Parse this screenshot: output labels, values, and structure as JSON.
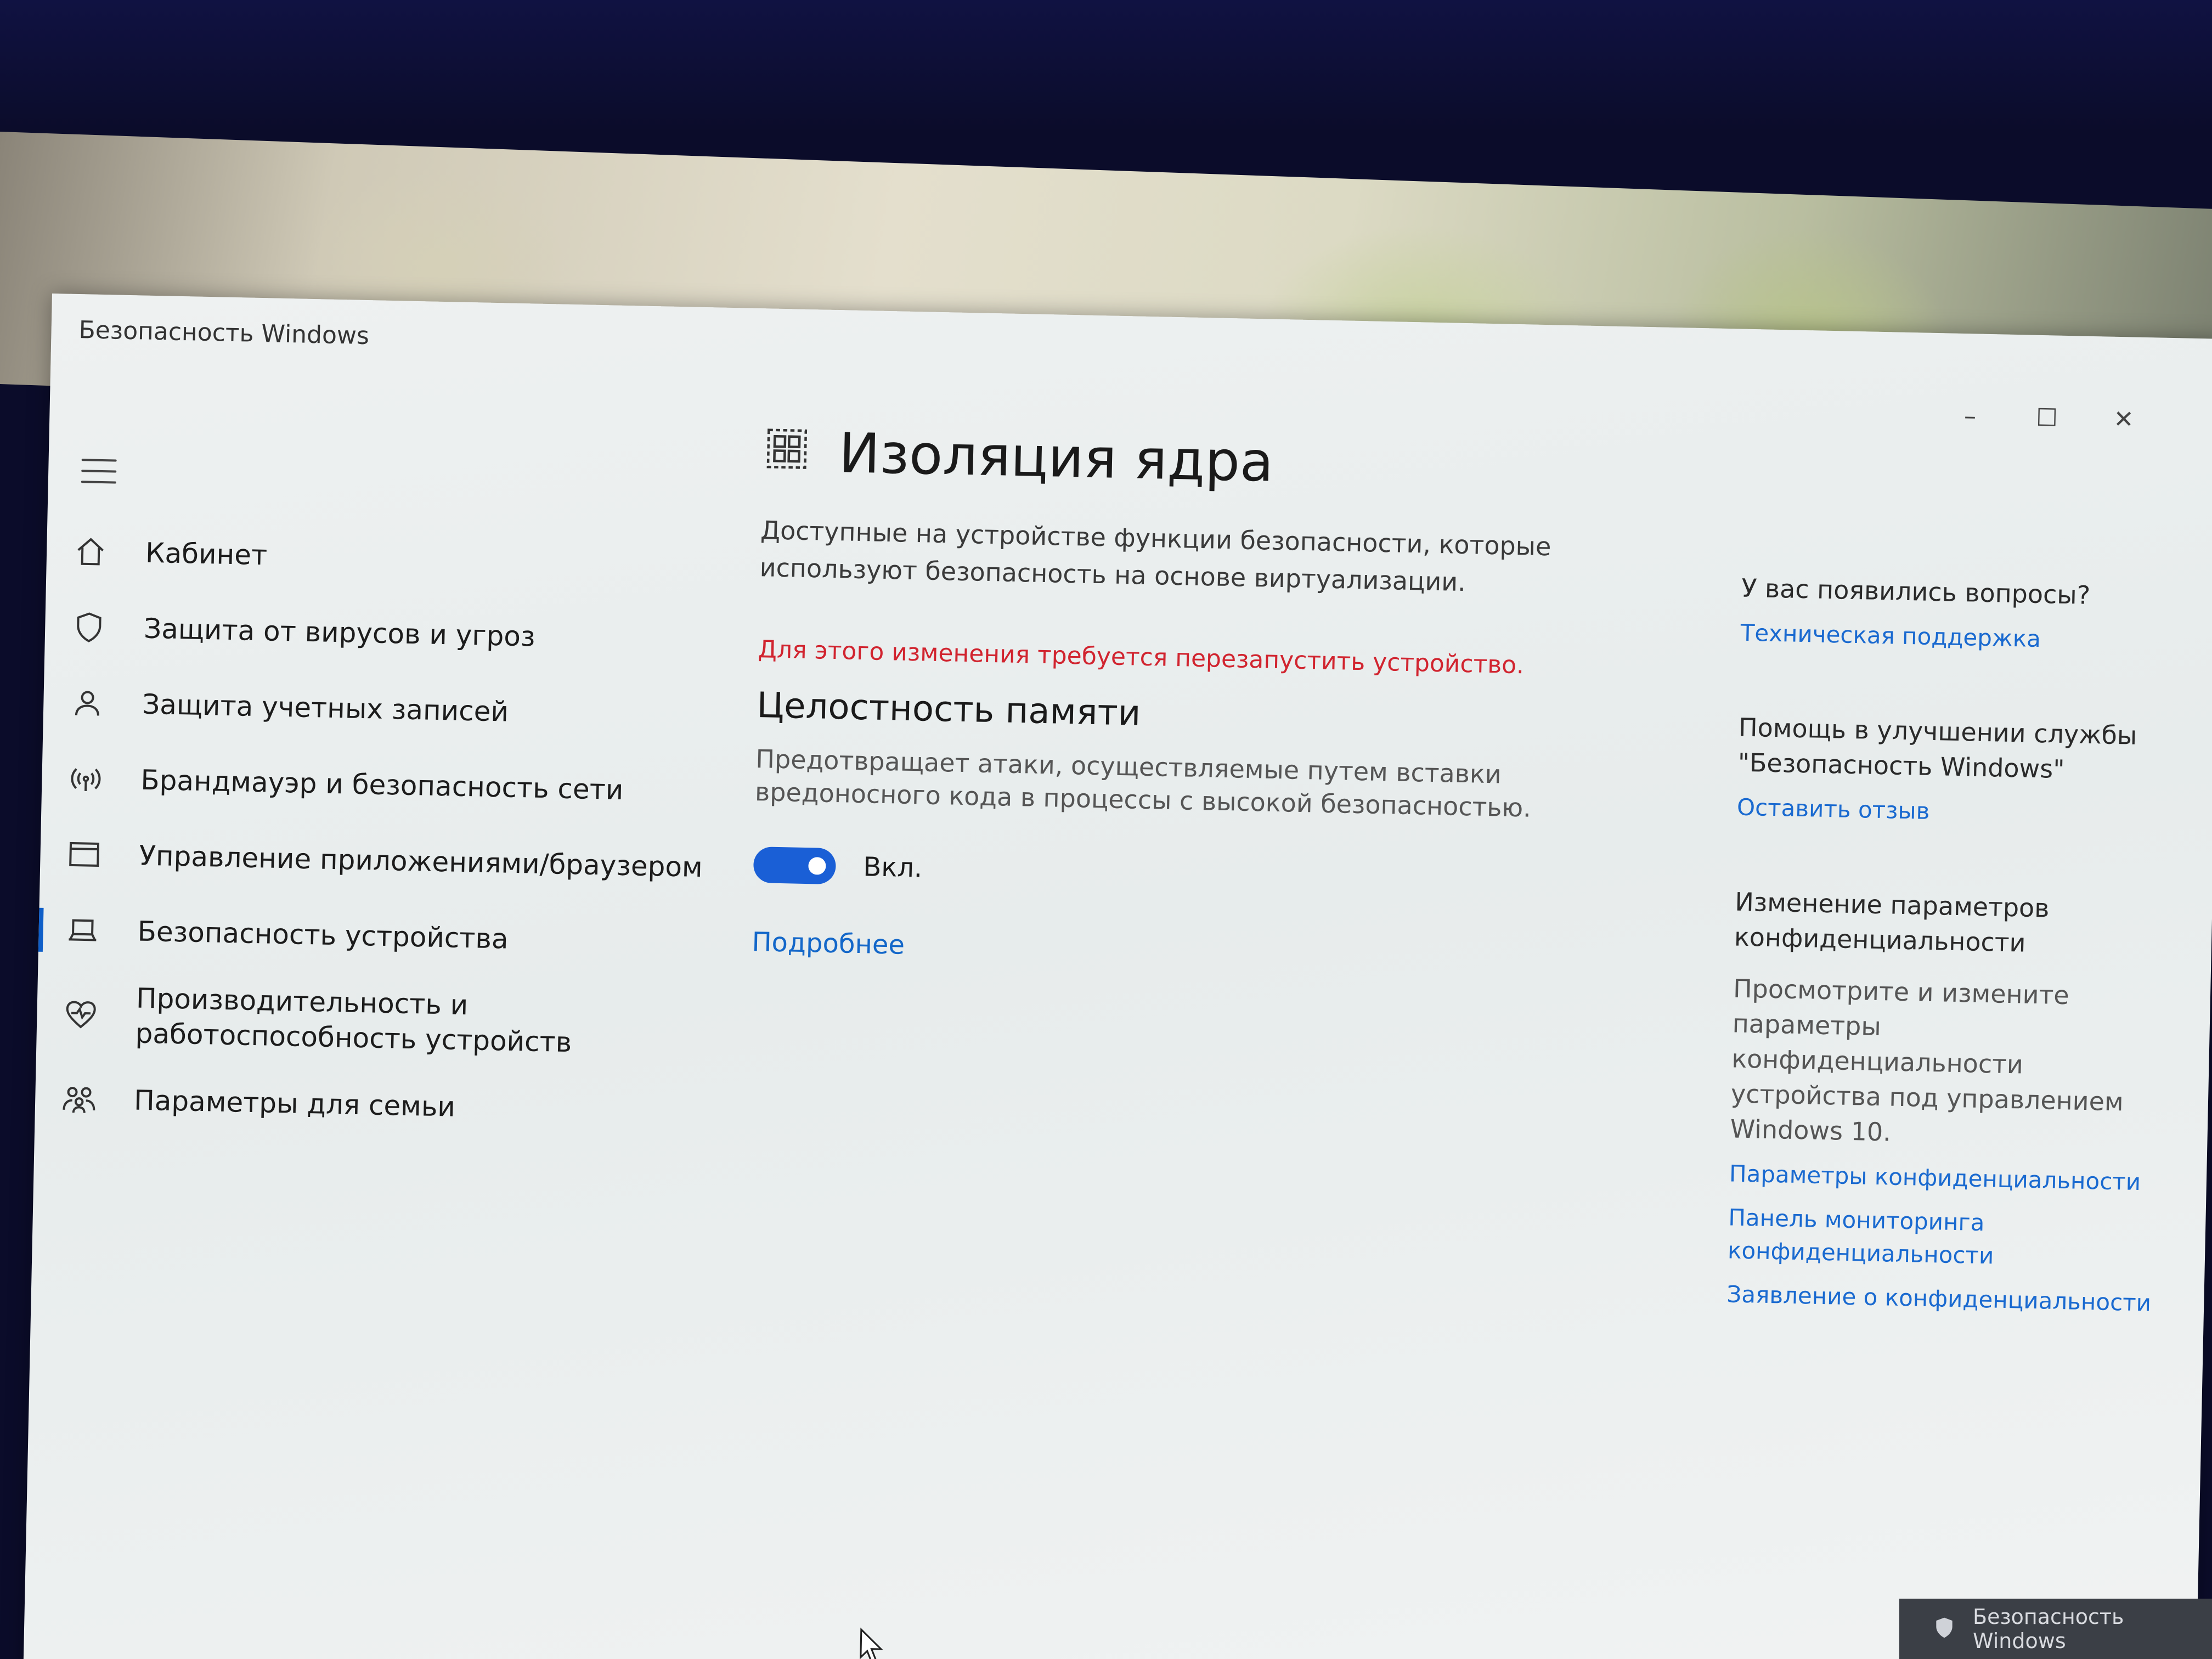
{
  "window": {
    "title": "Безопасность Windows",
    "controls": {
      "minimize": "–",
      "maximize": "☐",
      "close": "✕"
    }
  },
  "sidebar": {
    "items": [
      {
        "label": "Кабинет",
        "icon": "home-icon"
      },
      {
        "label": "Защита от вирусов и угроз",
        "icon": "shield-icon"
      },
      {
        "label": "Защита учетных записей",
        "icon": "person-icon"
      },
      {
        "label": "Брандмауэр и безопасность сети",
        "icon": "wifi-signal-icon"
      },
      {
        "label": "Управление приложениями/браузером",
        "icon": "browser-window-icon"
      },
      {
        "label": "Безопасность устройства",
        "icon": "laptop-icon",
        "active": true
      },
      {
        "label": "Производительность и\nработоспособность устройств",
        "icon": "heart-pulse-icon"
      },
      {
        "label": "Параметры для семьи",
        "icon": "family-icon"
      }
    ]
  },
  "main": {
    "title": "Изоляция ядра",
    "description": "Доступные на устройстве функции безопасности, которые используют безопасность на основе виртуализации.",
    "warning": "Для этого изменения требуется перезапустить устройство.",
    "section": {
      "title": "Целостность памяти",
      "description": "Предотвращает атаки, осуществляемые путем вставки вредоносного кода в процессы с высокой безопасностью.",
      "toggle_label": "Вкл.",
      "toggle_state": true
    },
    "more_link": "Подробнее"
  },
  "side": {
    "questions_heading": "У вас появились вопросы?",
    "support_link": "Техническая поддержка",
    "improve_heading": "Помощь в улучшении службы \"Безопасность Windows\"",
    "feedback_link": "Оставить отзыв",
    "privacy_heading": "Изменение параметров конфиденциальности",
    "privacy_text": "Просмотрите и измените параметры конфиденциальности устройства под управлением Windows 10.",
    "privacy_settings_link": "Параметры конфиденциальности",
    "privacy_dashboard_link": "Панель мониторинга конфиденциальности",
    "privacy_statement_link": "Заявление о конфиденциальности"
  },
  "taskbar": {
    "label": "Безопасность Windows"
  },
  "colors": {
    "accent": "#1a5fd6",
    "link": "#1367c9",
    "warning": "#d1242f"
  }
}
